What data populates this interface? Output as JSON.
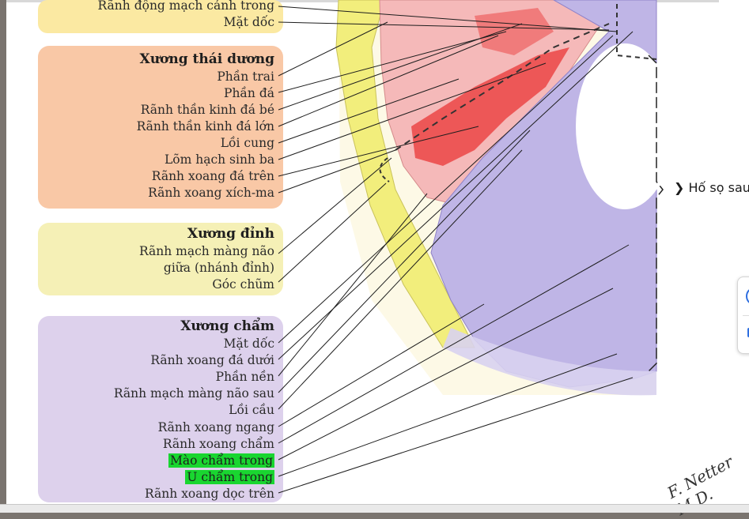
{
  "labels": {
    "clivus_sphenoid": "Rãnh động mạch cảnh trong",
    "clivus_top": "Mặt dốc",
    "temporal": {
      "title": "Xương thái dương",
      "items": [
        "Phần trai",
        "Phần đá",
        "Rãnh thần kinh đá bé",
        "Rãnh thần kinh đá lớn",
        "Lồi cung",
        "Lõm hạch sinh ba",
        "Rãnh xoang đá trên",
        "Rãnh xoang xích-ma"
      ]
    },
    "parietal": {
      "title": "Xương đỉnh",
      "items": [
        "Rãnh mạch màng não",
        "giữa (nhánh đỉnh)",
        "Góc chũm"
      ]
    },
    "occipital": {
      "title": "Xương chẩm",
      "items": [
        "Mặt dốc",
        "Rãnh xoang đá dưới",
        "Phần nền",
        "Rãnh mạch màng não sau",
        "Lồi cầu",
        "Rãnh xoang ngang",
        "Rãnh xoang chẩm",
        "Mào chẩm trong",
        "U chẩm trong",
        "Rãnh xoang dọc trên"
      ]
    }
  },
  "fossa_label": "Hố sọ sau",
  "signature": "F. Netter M.D.",
  "highlight_color": "#19d630"
}
